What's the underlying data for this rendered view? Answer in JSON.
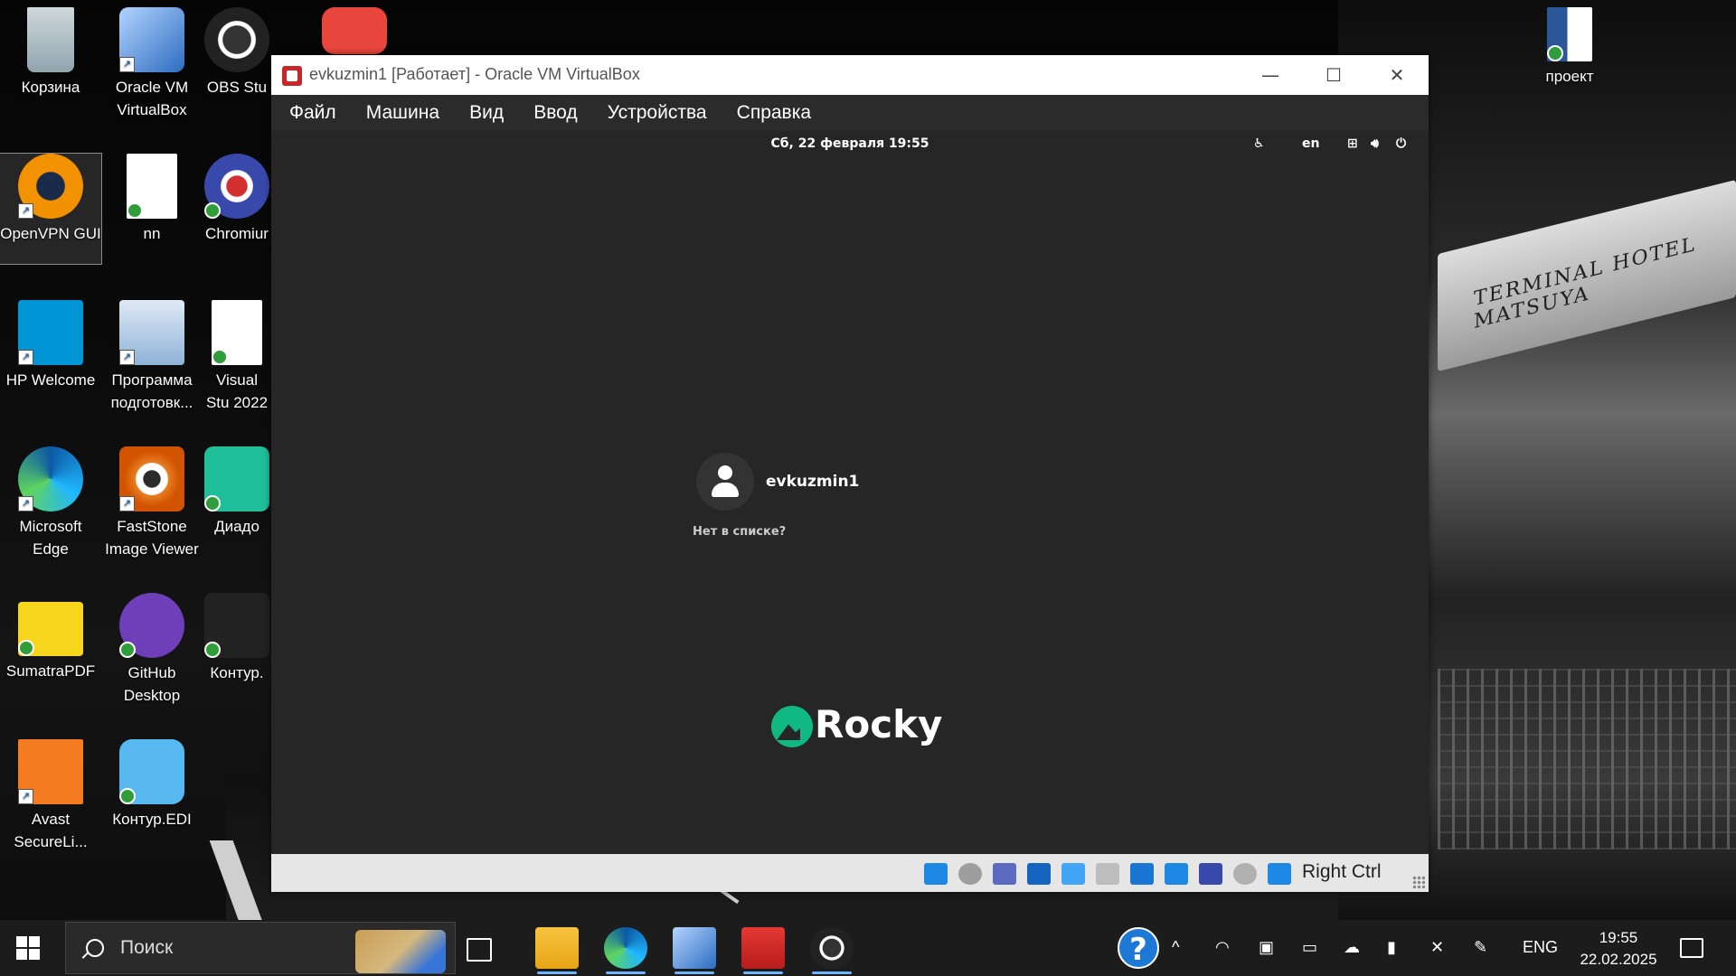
{
  "desktop": {
    "icons": [
      {
        "label": "Корзина",
        "icon": "recycle-bin-icon"
      },
      {
        "label": "Oracle VM VirtualBox",
        "icon": "virtualbox-icon"
      },
      {
        "label": "OBS Stu",
        "icon": "obs-icon"
      },
      {
        "label": "OpenVPN GUI",
        "icon": "openvpn-icon"
      },
      {
        "label": "nn",
        "icon": "document-icon"
      },
      {
        "label": "Chromiur",
        "icon": "chromium-icon"
      },
      {
        "label": "HP Welcome",
        "icon": "hp-icon"
      },
      {
        "label": "Программа подготовк...",
        "icon": "program-icon"
      },
      {
        "label": "Visual Stu 2022",
        "icon": "document-icon"
      },
      {
        "label": "Microsoft Edge",
        "icon": "edge-icon"
      },
      {
        "label": "FastStone Image Viewer",
        "icon": "faststone-icon"
      },
      {
        "label": "Диадо",
        "icon": "diadoc-icon"
      },
      {
        "label": "SumatraPDF",
        "icon": "sumatrapdf-icon"
      },
      {
        "label": "GitHub Desktop",
        "icon": "github-icon"
      },
      {
        "label": "Контур.",
        "icon": "kontur-icon"
      },
      {
        "label": "Avast SecureLi...",
        "icon": "avast-icon"
      },
      {
        "label": "Контур.EDI",
        "icon": "kontur-edi-icon"
      },
      {
        "label": "проект",
        "icon": "word-doc-icon"
      }
    ]
  },
  "wallpaper": {
    "sign_text": "TERMINAL HOTEL MATSUYA"
  },
  "vbox": {
    "title": "evkuzmin1 [Работает] - Oracle VM VirtualBox",
    "menu": [
      "Файл",
      "Машина",
      "Вид",
      "Ввод",
      "Устройства",
      "Справка"
    ],
    "guest": {
      "clock": "Сб, 22 февраля  19:55",
      "lang": "en",
      "username": "evkuzmin1",
      "not_listed": "Нет в списке?",
      "logo_text": "Rocky"
    },
    "status": {
      "host_key": "Right Ctrl"
    }
  },
  "taskbar": {
    "search_placeholder": "Поиск",
    "lang": "ENG",
    "time": "19:55",
    "date": "22.02.2025",
    "help": "?"
  },
  "colors": {
    "accent": "#1e78d6",
    "rocky_green": "#10b981",
    "guest_bg": "#262626"
  }
}
